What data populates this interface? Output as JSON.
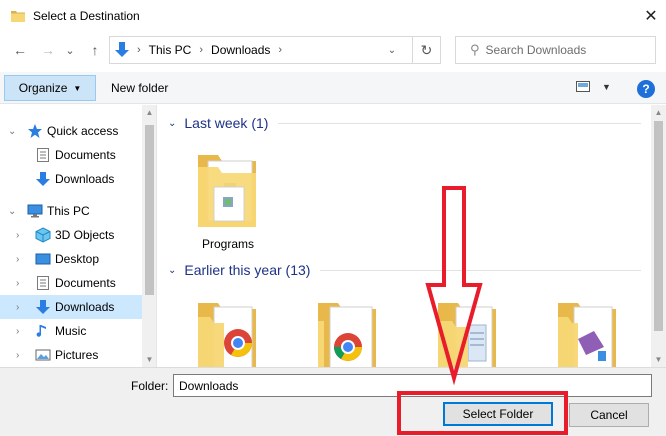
{
  "window": {
    "title": "Select a Destination",
    "close_glyph": "✕",
    "icon": "folder-icon"
  },
  "nav": {
    "back_glyph": "←",
    "forward_glyph": "→",
    "recent_glyph": "⌄",
    "up_glyph": "↑"
  },
  "address": {
    "crumbs": [
      "This PC",
      "Downloads"
    ],
    "separator": "›",
    "dropdown_glyph": "⌄",
    "refresh_glyph": "↻"
  },
  "search": {
    "placeholder": "Search Downloads",
    "icon_glyph": "⚲"
  },
  "toolbar": {
    "organize_label": "Organize",
    "organize_caret": "▼",
    "new_folder_label": "New folder",
    "view_caret": "▼",
    "help_label": "?"
  },
  "sidebar": {
    "items": [
      {
        "label": "Quick access",
        "icon": "star-icon"
      },
      {
        "label": "Documents",
        "icon": "document-icon"
      },
      {
        "label": "Downloads",
        "icon": "download-arrow-icon"
      },
      {
        "label": "This PC",
        "icon": "monitor-icon"
      },
      {
        "label": "3D Objects",
        "icon": "cube-icon"
      },
      {
        "label": "Desktop",
        "icon": "desktop-icon"
      },
      {
        "label": "Documents",
        "icon": "document-icon"
      },
      {
        "label": "Downloads",
        "icon": "download-arrow-icon",
        "selected": true
      },
      {
        "label": "Music",
        "icon": "music-note-icon"
      },
      {
        "label": "Pictures",
        "icon": "pictures-icon"
      }
    ],
    "collapsed_glyph": "›",
    "expanded_glyph": "⌄"
  },
  "content": {
    "groups": [
      {
        "title": "Last week (1)",
        "items": [
          "Programs"
        ]
      },
      {
        "title": "Earlier this year (13)",
        "items": []
      }
    ],
    "group_chevron": "⌄"
  },
  "bottom": {
    "folder_label": "Folder:",
    "folder_value": "Downloads",
    "select_label": "Select Folder",
    "cancel_label": "Cancel"
  },
  "scroll": {
    "up_glyph": "▲",
    "down_glyph": "▼"
  },
  "colors": {
    "accent": "#0078d7",
    "selection": "#cce8ff",
    "group_title": "#1e3287",
    "annotation": "#e81c2a",
    "folder": "#f7d774"
  }
}
